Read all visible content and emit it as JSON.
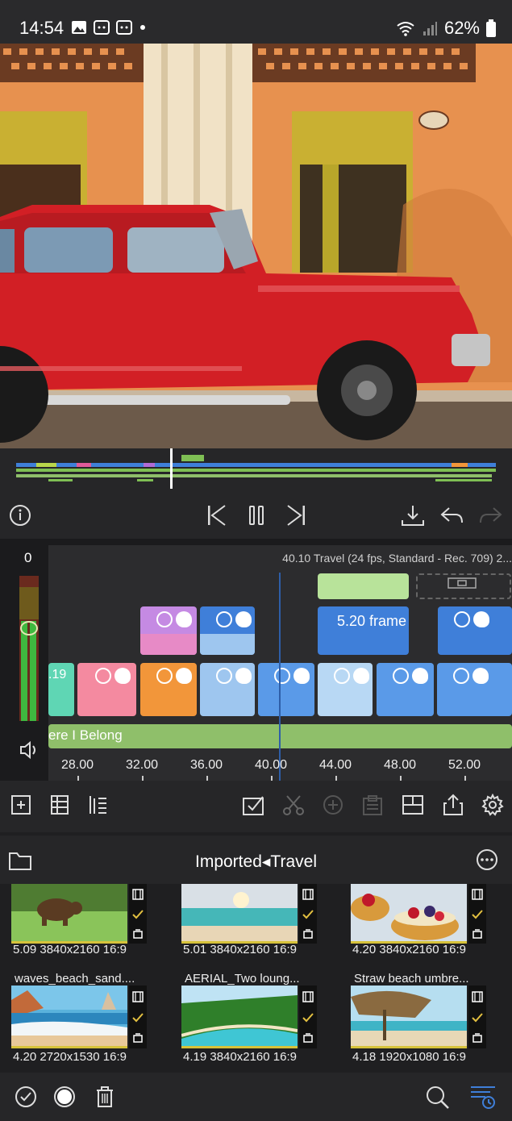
{
  "status_bar": {
    "time": "14:54",
    "battery": "62%",
    "icons": [
      "gallery-icon",
      "notification-icon",
      "notification-icon",
      "dot-icon",
      "wifi-icon",
      "signal-icon",
      "battery-icon"
    ]
  },
  "timeline": {
    "level_value": "0",
    "info": "40.10  Travel (24 fps, Standard - Rec. 709) 2...",
    "clip_label": "5.20 frame",
    "left_clip_label": ".19",
    "audio_label": "ere I Belong",
    "ruler": [
      "28.00",
      "32.00",
      "36.00",
      "40.00",
      "44.00",
      "48.00",
      "52.00"
    ]
  },
  "browser": {
    "title": "Imported◂Travel",
    "items": [
      {
        "meta": "5.09 3840x2160 16:9",
        "name": ""
      },
      {
        "meta": "5.01 3840x2160 16:9",
        "name": ""
      },
      {
        "meta": "4.20 3840x2160 16:9",
        "name": ""
      },
      {
        "meta": "4.20 2720x1530 16:9",
        "name": "waves_beach_sand...."
      },
      {
        "meta": "4.19 3840x2160 16:9",
        "name": "AERIAL_Two loung..."
      },
      {
        "meta": "4.18 1920x1080 16:9",
        "name": "Straw beach umbre..."
      }
    ]
  },
  "colors": {
    "accent_blue": "#3f7fd9",
    "clip_purple": "#b06ad6",
    "clip_orange": "#f2963a",
    "clip_pink": "#f48aa0",
    "clip_teal": "#5fd6b4",
    "audio_green": "#8fbf6a",
    "selection_yellow": "#d6c23a"
  }
}
